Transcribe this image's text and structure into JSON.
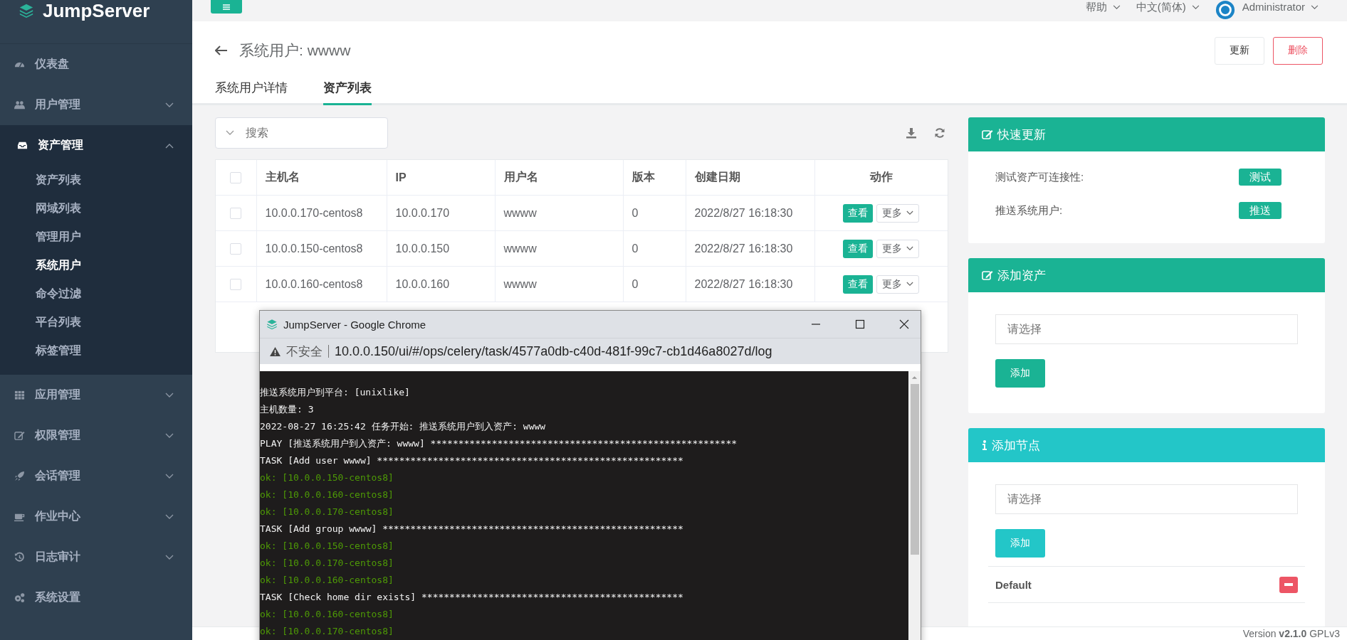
{
  "sidebar": {
    "logo": "JumpServer",
    "items": [
      {
        "label": "仪表盘",
        "expandable": false,
        "expanded": false
      },
      {
        "label": "用户管理",
        "expandable": true,
        "expanded": false
      },
      {
        "label": "资产管理",
        "expandable": true,
        "expanded": true,
        "children": [
          {
            "label": "资产列表",
            "selected": false
          },
          {
            "label": "网域列表",
            "selected": false
          },
          {
            "label": "管理用户",
            "selected": false
          },
          {
            "label": "系统用户",
            "selected": true
          },
          {
            "label": "命令过滤",
            "selected": false
          },
          {
            "label": "平台列表",
            "selected": false
          },
          {
            "label": "标签管理",
            "selected": false
          }
        ]
      },
      {
        "label": "应用管理",
        "expandable": true,
        "expanded": false
      },
      {
        "label": "权限管理",
        "expandable": true,
        "expanded": false
      },
      {
        "label": "会话管理",
        "expandable": true,
        "expanded": false
      },
      {
        "label": "作业中心",
        "expandable": true,
        "expanded": false
      },
      {
        "label": "日志审计",
        "expandable": true,
        "expanded": false
      },
      {
        "label": "系统设置",
        "expandable": false,
        "expanded": false
      }
    ]
  },
  "topbar": {
    "help": "帮助",
    "language": "中文(简体)",
    "user": "Administrator"
  },
  "page": {
    "title": "系统用户: wwww",
    "buttons": [
      {
        "label": "更新",
        "kind": "default"
      },
      {
        "label": "删除",
        "kind": "danger"
      }
    ],
    "tabs": [
      {
        "label": "系统用户详情",
        "selected": false
      },
      {
        "label": "资产列表",
        "selected": true
      }
    ]
  },
  "search": {
    "placeholder": "搜索"
  },
  "table": {
    "header_checked": false,
    "columns": [
      "主机名",
      "IP",
      "用户名",
      "版本",
      "创建日期",
      "动作"
    ],
    "rows": [
      {
        "checked": false,
        "cells": [
          "10.0.0.170-centos8",
          "10.0.0.170",
          "wwww",
          "0",
          "2022/8/27 16:18:30"
        ],
        "actions": [
          "查看",
          "更多"
        ]
      },
      {
        "checked": false,
        "cells": [
          "10.0.0.150-centos8",
          "10.0.0.150",
          "wwww",
          "0",
          "2022/8/27 16:18:30"
        ],
        "actions": [
          "查看",
          "更多"
        ]
      },
      {
        "checked": false,
        "cells": [
          "10.0.0.160-centos8",
          "10.0.0.160",
          "wwww",
          "0",
          "2022/8/27 16:18:30"
        ],
        "actions": [
          "查看",
          "更多"
        ]
      }
    ]
  },
  "panels": [
    {
      "kind": "actions",
      "title": "快速更新",
      "color": "#1ab394",
      "rows": [
        {
          "label": "测试资产可连接性:",
          "button": "测试"
        },
        {
          "label": "推送系统用户:",
          "button": "推送"
        }
      ]
    },
    {
      "kind": "picker",
      "title": "添加资产",
      "color": "#1ab394",
      "placeholder": "请选择",
      "button": "添加"
    },
    {
      "kind": "picker",
      "title": "添加节点",
      "color": "#23c6c8",
      "placeholder": "请选择",
      "button": "添加",
      "nodes": [
        {
          "name": "Default"
        }
      ]
    }
  ],
  "footer": {
    "version": "Version **v2.1.0** GPLv3"
  },
  "browser_window": {
    "title": "JumpServer - Google Chrome",
    "security": "不安全",
    "url": "10.0.0.150/ui/#/ops/celery/task/4577a0db-c40d-481f-99c7-cb1d46a8027d/log",
    "log": [
      {
        "kind": "plain",
        "text": "推送系统用户到平台: [unixlike]"
      },
      {
        "kind": "plain",
        "text": "主机数量: 3"
      },
      {
        "kind": "plain",
        "text": "2022-08-27 16:25:42 任务开始: 推送系统用户到入资产: wwww"
      },
      {
        "kind": "plain",
        "text": "PLAY [推送系统用户到入资产: wwww] *******************************************************"
      },
      {
        "kind": "plain",
        "text": "TASK [Add user wwww] *******************************************************"
      },
      {
        "kind": "ok",
        "text": "ok: [10.0.0.150-centos8]"
      },
      {
        "kind": "ok",
        "text": "ok: [10.0.0.160-centos8]"
      },
      {
        "kind": "ok",
        "text": "ok: [10.0.0.170-centos8]"
      },
      {
        "kind": "plain",
        "text": "TASK [Add group wwww] ******************************************************"
      },
      {
        "kind": "ok",
        "text": "ok: [10.0.0.150-centos8]"
      },
      {
        "kind": "ok",
        "text": "ok: [10.0.0.170-centos8]"
      },
      {
        "kind": "ok",
        "text": "ok: [10.0.0.160-centos8]"
      },
      {
        "kind": "plain",
        "text": "TASK [Check home dir exists] ***********************************************"
      },
      {
        "kind": "ok",
        "text": "ok: [10.0.0.160-centos8]"
      },
      {
        "kind": "ok",
        "text": "ok: [10.0.0.170-centos8]"
      }
    ]
  }
}
